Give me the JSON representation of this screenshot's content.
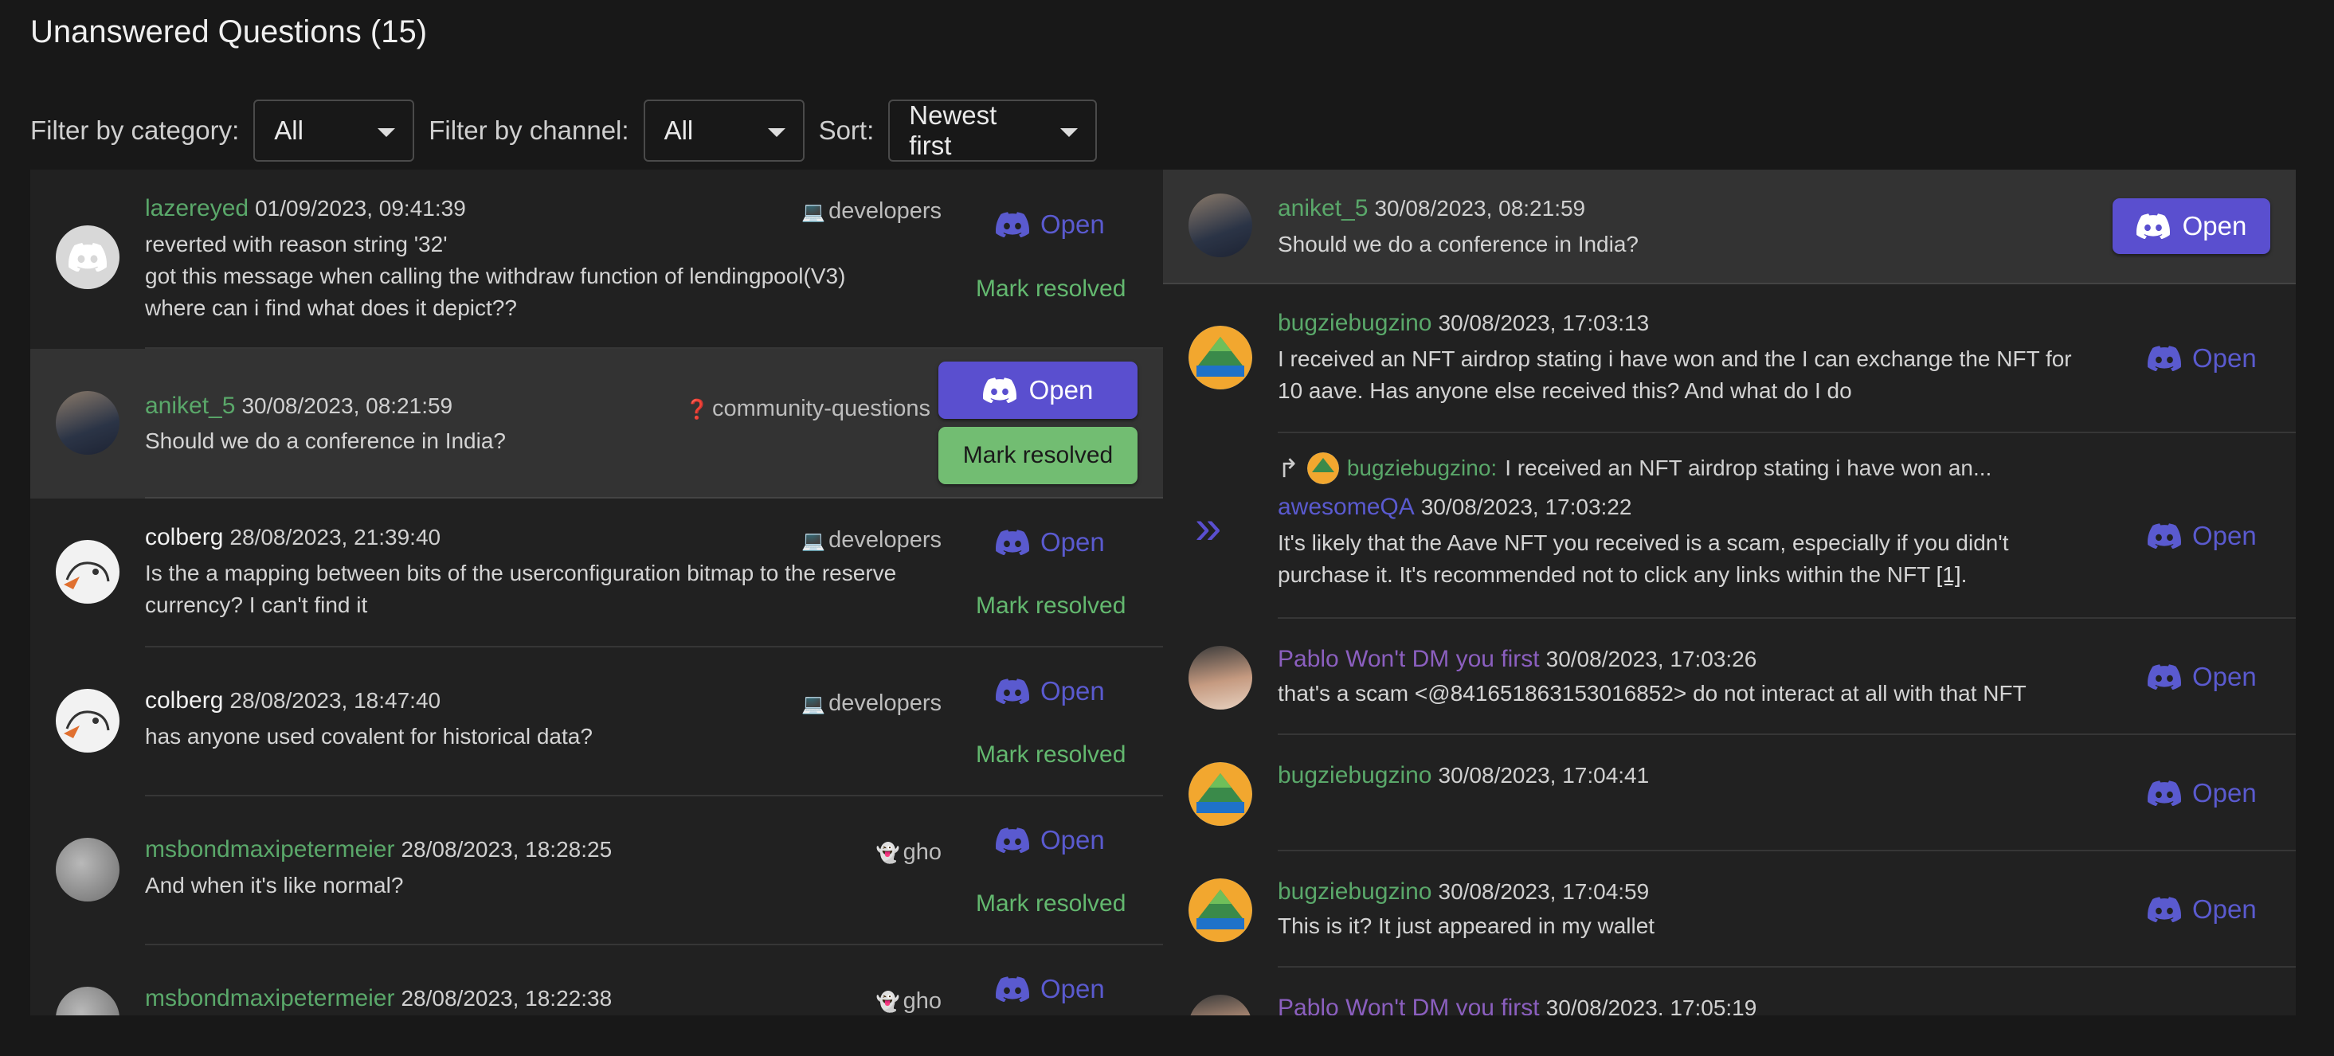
{
  "header": {
    "title": "Unanswered Questions (15)"
  },
  "filters": {
    "category_label": "Filter by category:",
    "category_value": "All",
    "channel_label": "Filter by channel:",
    "channel_value": "All",
    "sort_label": "Sort:",
    "sort_value": "Newest first"
  },
  "actions": {
    "open_label": "Open",
    "resolve_label": "Mark resolved"
  },
  "colors": {
    "accent": "#5a4fcf",
    "resolve": "#72bd72",
    "username": "#5aa86a",
    "background": "#181818"
  },
  "questions": [
    {
      "user": "lazereyed",
      "time": "01/09/2023, 09:41:39",
      "channel_icon": "laptop-icon",
      "channel": "developers",
      "lines": [
        "reverted with reason string '32'",
        "got this message when calling the withdraw function of lendingpool(V3)",
        "where can i find what does it depict??"
      ]
    },
    {
      "user": "aniket_5",
      "time": "30/08/2023, 08:21:59",
      "channel_icon": "question-icon",
      "channel": "community-questions",
      "lines": [
        "Should we do a conference in India?"
      ]
    },
    {
      "user": "colberg",
      "time": "28/08/2023, 21:39:40",
      "channel_icon": "laptop-icon",
      "channel": "developers",
      "lines": [
        "Is the a mapping between bits of the userconfiguration bitmap to the reserve",
        "currency? I can't find it"
      ]
    },
    {
      "user": "colberg",
      "time": "28/08/2023, 18:47:40",
      "channel_icon": "laptop-icon",
      "channel": "developers",
      "lines": [
        "has anyone used covalent for historical data?"
      ]
    },
    {
      "user": "msbondmaxipetermeier",
      "time": "28/08/2023, 18:28:25",
      "channel_icon": "ghost-icon",
      "channel": "gho",
      "lines": [
        "And when it's like normal?"
      ]
    },
    {
      "user": "msbondmaxipetermeier",
      "time": "28/08/2023, 18:22:38",
      "channel_icon": "ghost-icon",
      "channel": "gho",
      "lines": []
    }
  ],
  "thread": [
    {
      "user": "aniket_5",
      "time": "30/08/2023, 08:21:59",
      "lines": [
        "Should we do a conference in India?"
      ]
    },
    {
      "user": "bugziebugzino",
      "time": "30/08/2023, 17:03:13",
      "lines": [
        "I received an NFT airdrop stating i have won and the I can exchange the NFT for",
        "10 aave. Has anyone else received this? And what do I do"
      ]
    },
    {
      "user": "awesomeQA",
      "time": "30/08/2023, 17:03:22",
      "reply_to_user": "bugziebugzino:",
      "reply_to_text": "I received an NFT airdrop stating i have won an...",
      "lines": [
        "It's likely that the Aave NFT you received is a scam, especially if you didn't"
      ],
      "line2_prefix": "purchase it. It's recommended not to click any links within the NFT ",
      "line2_ref": "[1]",
      "line2_suffix": "."
    },
    {
      "user": "Pablo Won't DM you first",
      "time": "30/08/2023, 17:03:26",
      "lines": [
        "that's a scam <@841651863153016852> do not interact at all with that NFT"
      ]
    },
    {
      "user": "bugziebugzino",
      "time": "30/08/2023, 17:04:41",
      "lines": []
    },
    {
      "user": "bugziebugzino",
      "time": "30/08/2023, 17:04:59",
      "lines": [
        "This is it? It just appeared in my wallet"
      ]
    },
    {
      "user": "Pablo Won't DM you first",
      "time": "30/08/2023, 17:05:19",
      "lines": []
    }
  ]
}
